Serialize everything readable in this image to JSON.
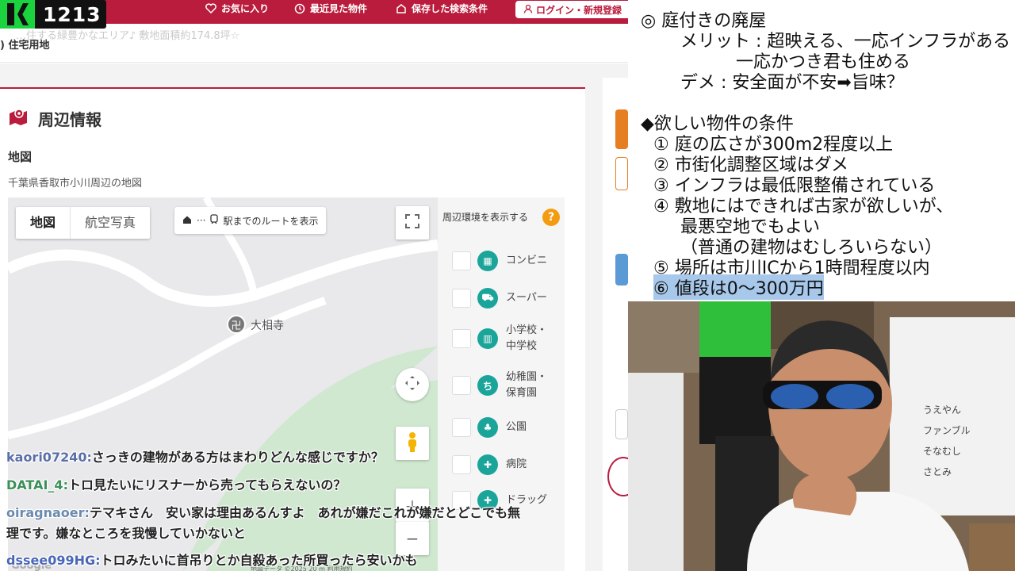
{
  "header": {
    "nav": [
      {
        "label": "お気に入り",
        "icon": "heart-icon"
      },
      {
        "label": "最近見た物件",
        "icon": "clock-icon"
      },
      {
        "label": "保存した検索条件",
        "icon": "bookmark-icon"
      }
    ],
    "login_label": "ログイン・新規登録",
    "accent_color": "#b91c3c"
  },
  "viewer_badge": {
    "count": "1213"
  },
  "listing": {
    "faded_caption": "…住する緑豊かなエリア♪ 敷地面積約174.8坪☆",
    "land_type": "住宅用地"
  },
  "surroundings": {
    "title": "周辺情報",
    "map_heading": "地図",
    "map_description": "千葉県香取市小川周辺の地図",
    "map_tabs": [
      "地図",
      "航空写真"
    ],
    "route_label": "駅までのルートを表示",
    "place_label": "大相寺",
    "map_footer": "地図データ ©2025   20 m        利用規約",
    "google_label": "Google",
    "env_header": "周辺環境を表示する",
    "env_items": [
      {
        "label": "コンビニ",
        "icon": "convenience-store-icon"
      },
      {
        "label": "スーパー",
        "icon": "cart-icon"
      },
      {
        "label": "小学校・\n中学校",
        "icon": "school-icon"
      },
      {
        "label": "幼稚園・\n保育園",
        "icon": "kindergarten-icon"
      },
      {
        "label": "公園",
        "icon": "park-icon"
      },
      {
        "label": "病院",
        "icon": "hospital-icon"
      },
      {
        "label": "ドラッグ",
        "icon": "drugstore-icon"
      }
    ]
  },
  "chat": [
    {
      "user": "kaori07240:",
      "message": "さっきの建物がある方はまわりどんな感じですか？"
    },
    {
      "user": "DATAI_4:",
      "message": "トロ見たいにリスナーから売ってもらえないの？"
    },
    {
      "user": "oiragnaoer:",
      "message": "テマキさん　安い家は理由あるんすよ　あれが嫌だこれが嫌だとどこでも無"
    },
    {
      "user": "",
      "message": "理です。嫌なところを我慢していかないと"
    },
    {
      "user": "dssee099HG:",
      "message": "トロみたいに首吊りとか自殺あった所買ったら安いかも"
    }
  ],
  "notes": {
    "lines": [
      "◎ 庭付きの廃屋",
      "メリット : 超映える、一応インフラがある",
      "一応かつき君も住める",
      "デメ : 安全面が不安➡旨味？",
      "◆欲しい物件の条件",
      "① 庭の広さが300m2程度以上",
      "② 市街化調整区域はダメ",
      "③ インフラは最低限整備されている",
      "④ 敷地にはできれば古家が欲しいが、",
      "最悪空地でもよい",
      "（普通の建物はむしろいらない）",
      "⑤ 場所は市川ICから1時間程度以内",
      "⑥ 値段は0～300万円"
    ]
  },
  "webcam": {
    "names": [
      "うえやん",
      "ファンブル",
      "そなむし",
      "さとみ"
    ]
  }
}
